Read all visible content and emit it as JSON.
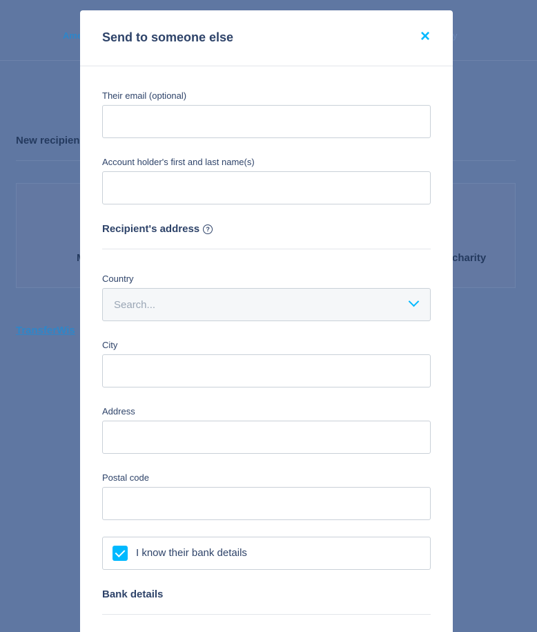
{
  "background": {
    "nav_left": "Ame",
    "nav_right": "y",
    "new_recipient": "New recipien",
    "card_left": "M",
    "card_right": "charity",
    "link": "TransferWis"
  },
  "modal": {
    "title": "Send to someone else",
    "close_icon": "×",
    "email": {
      "label": "Their email (optional)",
      "value": ""
    },
    "name": {
      "label": "Account holder's first and last name(s)",
      "value": ""
    },
    "address_section": {
      "title": "Recipient's address",
      "info_icon": "?"
    },
    "country": {
      "label": "Country",
      "placeholder": "Search..."
    },
    "city": {
      "label": "City",
      "value": ""
    },
    "address": {
      "label": "Address",
      "value": ""
    },
    "postal": {
      "label": "Postal code",
      "value": ""
    },
    "bank_checkbox": {
      "label": "I know their bank details",
      "checked": true
    },
    "bank_section": {
      "title": "Bank details"
    }
  },
  "colors": {
    "accent": "#00b9ff",
    "heading": "#2e4369",
    "overlay": "#5f77a2"
  }
}
